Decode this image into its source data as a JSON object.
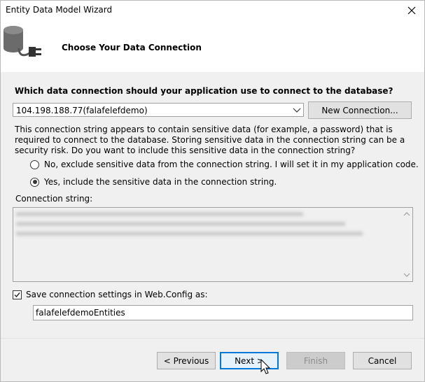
{
  "window": {
    "title": "Entity Data Model Wizard"
  },
  "header": {
    "title": "Choose Your Data Connection",
    "icon": "database-connection-icon"
  },
  "connection": {
    "question": "Which data connection should your application use to connect to the database?",
    "selected": "104.198.188.77(falafelefdemo)",
    "new_connection_label": "New Connection...",
    "sensitive_notice": "This connection string appears to contain sensitive data (for example, a password) that is required to connect to the database. Storing sensitive data in the connection string can be a security risk. Do you want to include this sensitive data in the connection string?",
    "option_no": "No, exclude sensitive data from the connection string. I will set it in my application code.",
    "option_yes": "Yes, include the sensitive data in the connection string.",
    "selected_option": "yes",
    "string_label": "Connection string:"
  },
  "save": {
    "checked": true,
    "label": "Save connection settings in Web.Config as:",
    "value": "falafelefdemoEntities"
  },
  "buttons": {
    "previous": "< Previous",
    "next": "Next >",
    "finish": "Finish",
    "cancel": "Cancel"
  },
  "colors": {
    "accent": "#0078d7",
    "header_bg": "#ffffff",
    "dialog_bg": "#f0f0f0"
  }
}
